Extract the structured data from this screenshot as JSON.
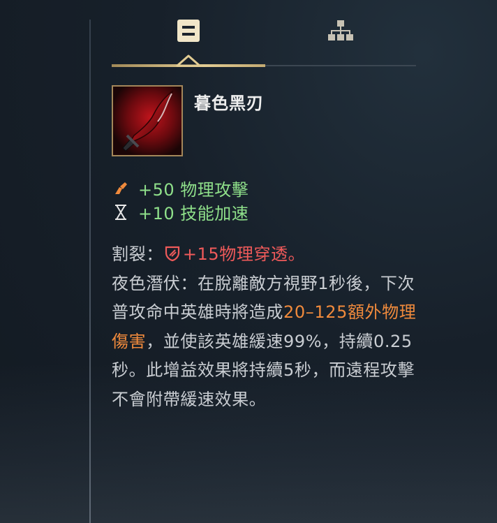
{
  "tabs": [
    {
      "id": "info",
      "icon": "item-info-icon",
      "active": true
    },
    {
      "id": "tree",
      "icon": "build-tree-icon",
      "active": false
    }
  ],
  "item": {
    "name": "暮色黑刃",
    "icon": "crimson-blade-icon"
  },
  "stats": [
    {
      "icon": "attack-damage-icon",
      "text": "+50 物理攻擊",
      "color": "#8fe08a"
    },
    {
      "icon": "hourglass-icon",
      "text": "+10 技能加速",
      "color": "#8fe08a"
    }
  ],
  "passives": {
    "p1_label": "割裂：",
    "p1_effect": "+15物理穿透。",
    "p2_label": "夜色潛伏：",
    "p2_text_a": "在脫離敵方視野1秒後，下次普攻命中英雄時將造成",
    "p2_damage": "20–125額外物理傷害",
    "p2_text_b": "，並使該英雄緩速99%，持續0.25秒。此增益效果將持續5秒，而遠程攻擊不會附帶緩速效果。"
  },
  "colors": {
    "accent_gold": "#e2cc93",
    "stat_green": "#8fe08a",
    "penetration_red": "#ef5a5a",
    "damage_orange": "#f08a3c"
  }
}
